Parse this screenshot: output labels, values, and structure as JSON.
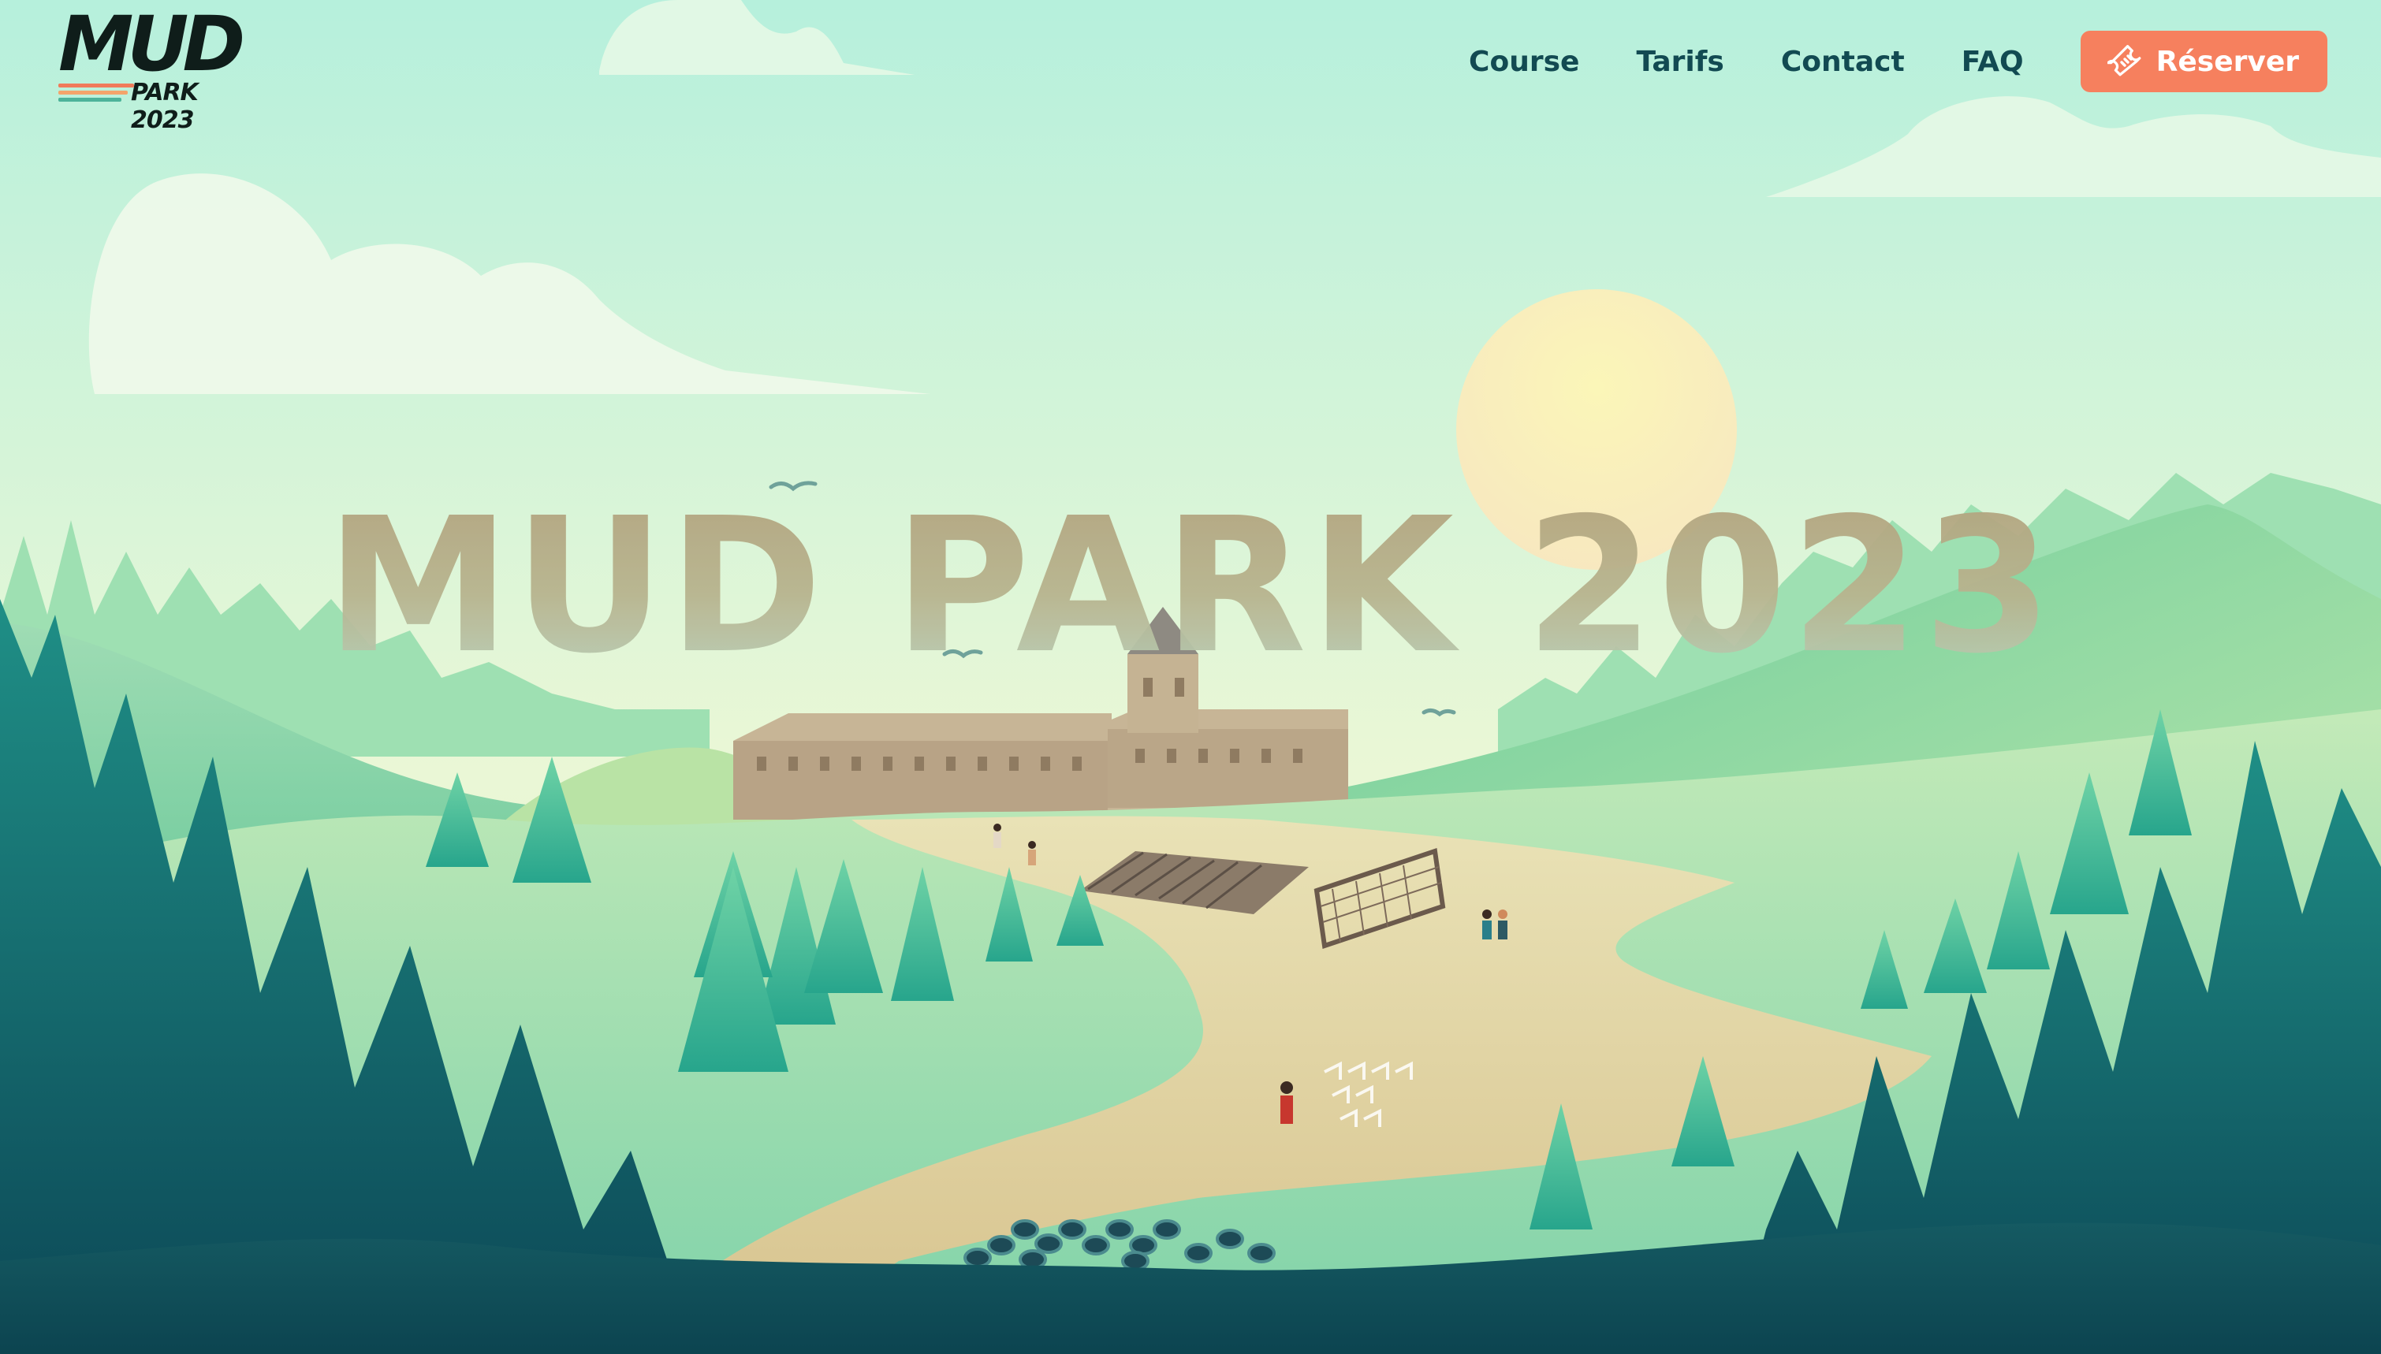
{
  "header": {
    "logo": {
      "word": "MUD",
      "subtitle": "PARK 2023"
    },
    "nav": [
      {
        "label": "Course"
      },
      {
        "label": "Tarifs"
      },
      {
        "label": "Contact"
      },
      {
        "label": "FAQ"
      }
    ],
    "cta": {
      "label": "Réserver",
      "icon": "ticket-icon"
    }
  },
  "hero": {
    "title": "MUD PARK 2023"
  },
  "colors": {
    "accent": "#f6805e",
    "nav_text": "#124a52",
    "sky_top": "#b6f0dc",
    "sky_bottom": "#f5f7d0",
    "forest_dark": "#0f4f5c",
    "logo_stripes": [
      "#f07b5a",
      "#f3a46b",
      "#4db39a"
    ]
  }
}
